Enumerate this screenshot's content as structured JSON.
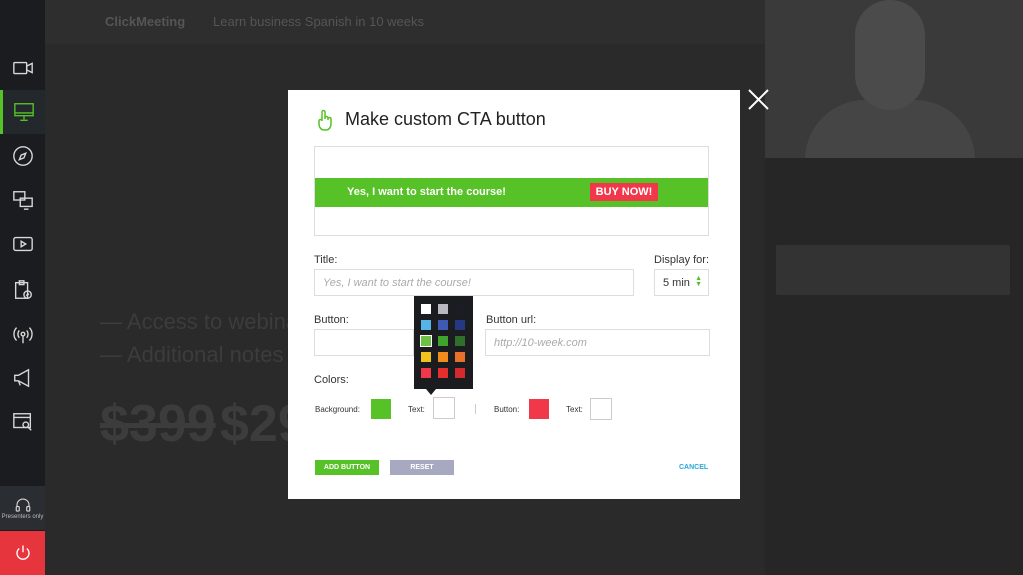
{
  "app": {
    "logo_text": "ClickMeeting",
    "event_title": "Learn business Spanish in 10 weeks"
  },
  "sidebar": {
    "items": [
      {
        "icon": "video-camera-icon"
      },
      {
        "icon": "presentation-icon",
        "active": true
      },
      {
        "icon": "compass-icon"
      },
      {
        "icon": "screen-share-icon"
      },
      {
        "icon": "video-play-icon"
      },
      {
        "icon": "clipboard-check-icon"
      },
      {
        "icon": "broadcast-icon"
      },
      {
        "icon": "megaphone-icon"
      },
      {
        "icon": "search-window-icon"
      }
    ],
    "presenters_label": "Presenters only"
  },
  "background": {
    "line1": "— Access to webinar",
    "line2": "— Additional notes",
    "price_old": "$399",
    "price_new": "$29"
  },
  "modal": {
    "title": "Make custom CTA button",
    "preview": {
      "text": "Yes, I want to start the course!",
      "button": "BUY NOW!",
      "bar_color": "#57c128",
      "button_color": "#f1374a"
    },
    "title_label": "Title:",
    "title_placeholder": "Yes, I want to start the course!",
    "display_label": "Display for:",
    "display_value": "5 min",
    "button_label": "Button:",
    "button_url_label": "Button url:",
    "button_url_placeholder": "http://10-week.com",
    "colors_label": "Colors:",
    "background_label": "Background:",
    "text_label": "Text:",
    "button_color_label": "Button:",
    "text2_label": "Text:",
    "colors": {
      "background": "#57c128",
      "text": "#ffffff",
      "button": "#f1374a",
      "button_text": "#ffffff"
    },
    "palette": [
      [
        "#ffffff",
        "#b8b8c0",
        "#1c1c24"
      ],
      [
        "#56b4e9",
        "#3d5bb5",
        "#243884"
      ],
      [
        "#6dc145",
        "#3ea52a",
        "#2f6f2b"
      ],
      [
        "#f1c21b",
        "#f08c1e",
        "#e8702a"
      ],
      [
        "#f1374a",
        "#e62e2e",
        "#d32b2b"
      ]
    ],
    "add_button": "ADD BUTTON",
    "reset_button": "RESET",
    "cancel_button": "CANCEL"
  }
}
